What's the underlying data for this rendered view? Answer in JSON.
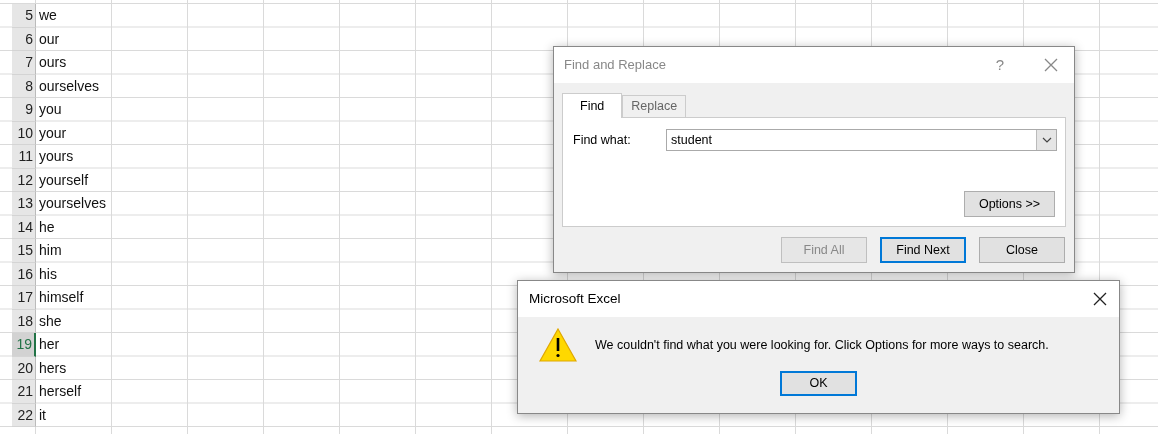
{
  "sheet": {
    "rows": [
      {
        "number": "5",
        "value": "we",
        "selected": false
      },
      {
        "number": "6",
        "value": "our",
        "selected": false
      },
      {
        "number": "7",
        "value": "ours",
        "selected": false
      },
      {
        "number": "8",
        "value": "ourselves",
        "selected": false
      },
      {
        "number": "9",
        "value": "you",
        "selected": false
      },
      {
        "number": "10",
        "value": "your",
        "selected": false
      },
      {
        "number": "11",
        "value": "yours",
        "selected": false
      },
      {
        "number": "12",
        "value": "yourself",
        "selected": false
      },
      {
        "number": "13",
        "value": "yourselves",
        "selected": false
      },
      {
        "number": "14",
        "value": "he",
        "selected": false
      },
      {
        "number": "15",
        "value": "him",
        "selected": false
      },
      {
        "number": "16",
        "value": "his",
        "selected": false
      },
      {
        "number": "17",
        "value": "himself",
        "selected": false
      },
      {
        "number": "18",
        "value": "she",
        "selected": false
      },
      {
        "number": "19",
        "value": "her",
        "selected": true
      },
      {
        "number": "20",
        "value": "hers",
        "selected": false
      },
      {
        "number": "21",
        "value": "herself",
        "selected": false
      },
      {
        "number": "22",
        "value": "it",
        "selected": false
      }
    ]
  },
  "find_dialog": {
    "title": "Find and Replace",
    "help": "?",
    "tabs": [
      {
        "label": "Find",
        "selected": true
      },
      {
        "label": "Replace",
        "selected": false
      }
    ],
    "find_what": {
      "label": "Find what:",
      "value": "student"
    },
    "options_button": "Options >>",
    "buttons": [
      {
        "label": "Find All",
        "disabled": true,
        "default": false
      },
      {
        "label": "Find Next",
        "disabled": false,
        "default": true
      },
      {
        "label": "Close",
        "disabled": false,
        "default": false
      }
    ]
  },
  "message_box": {
    "title": "Microsoft Excel",
    "message": "We couldn't find what you were looking for. Click Options for more ways to search.",
    "buttons": [
      {
        "label": "OK",
        "default": true
      }
    ]
  }
}
